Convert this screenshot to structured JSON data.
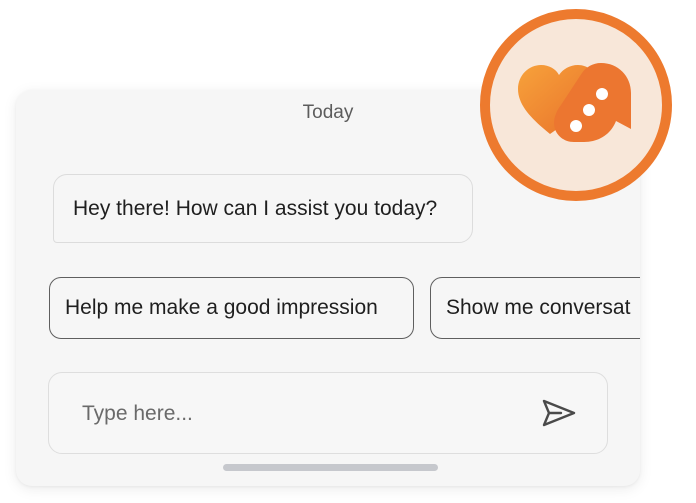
{
  "chat": {
    "date_label": "Today",
    "assistant_message": "Hey there! How can I assist you today?",
    "suggestions": [
      {
        "label": "Help me make a good impression"
      },
      {
        "label": "Show me conversat"
      }
    ],
    "input": {
      "placeholder": "Type here...",
      "value": ""
    },
    "send_icon": "send-icon"
  },
  "logo": {
    "icon": "chat-heart-logo-icon",
    "ring_color": "#ed7a2e",
    "fill_color": "#f8e7d9"
  },
  "colors": {
    "accent": "#ed7a2e",
    "card_background": "#f6f6f6",
    "text": "#1f1f1f"
  }
}
